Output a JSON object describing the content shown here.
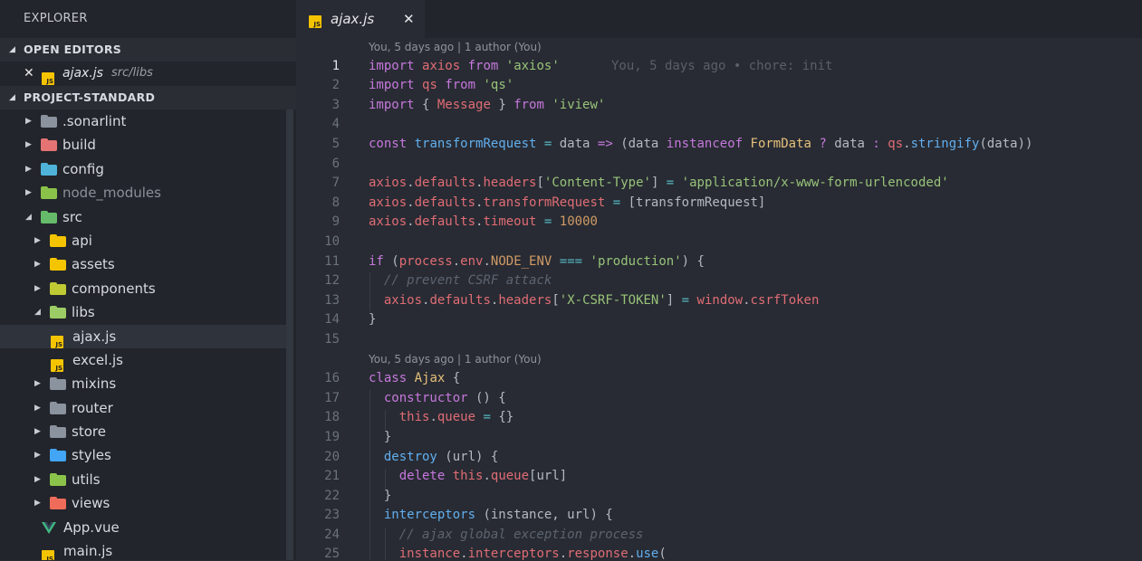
{
  "sidebar": {
    "title": "EXPLORER",
    "open_editors_label": "OPEN EDITORS",
    "open_editor": {
      "close": "✕",
      "name": "ajax.js",
      "path": "src/libs"
    },
    "project_label": "PROJECT-STANDARD",
    "tree": [
      {
        "name": ".sonarlint",
        "kind": "folder",
        "depth": 0,
        "expanded": false,
        "color": "#8a939e"
      },
      {
        "name": "build",
        "kind": "folder",
        "depth": 0,
        "expanded": false,
        "color": "#e57373"
      },
      {
        "name": "config",
        "kind": "folder",
        "depth": 0,
        "expanded": false,
        "color": "#4fb3d9"
      },
      {
        "name": "node_modules",
        "kind": "folder",
        "depth": 0,
        "expanded": false,
        "color": "#8bc34a"
      },
      {
        "name": "src",
        "kind": "folder",
        "depth": 0,
        "expanded": true,
        "color": "#66bb6a"
      },
      {
        "name": "api",
        "kind": "folder",
        "depth": 1,
        "expanded": false,
        "color": "#f5c400"
      },
      {
        "name": "assets",
        "kind": "folder",
        "depth": 1,
        "expanded": false,
        "color": "#f5c400"
      },
      {
        "name": "components",
        "kind": "folder",
        "depth": 1,
        "expanded": false,
        "color": "#c0ca33"
      },
      {
        "name": "libs",
        "kind": "folder",
        "depth": 1,
        "expanded": true,
        "color": "#9ccc65"
      },
      {
        "name": "ajax.js",
        "kind": "js",
        "depth": 2,
        "selected": true
      },
      {
        "name": "excel.js",
        "kind": "js",
        "depth": 2
      },
      {
        "name": "mixins",
        "kind": "folder",
        "depth": 1,
        "expanded": false,
        "color": "#8a939e"
      },
      {
        "name": "router",
        "kind": "folder",
        "depth": 1,
        "expanded": false,
        "color": "#8a939e"
      },
      {
        "name": "store",
        "kind": "folder",
        "depth": 1,
        "expanded": false,
        "color": "#8a939e"
      },
      {
        "name": "styles",
        "kind": "folder",
        "depth": 1,
        "expanded": false,
        "color": "#42a5f5"
      },
      {
        "name": "utils",
        "kind": "folder",
        "depth": 1,
        "expanded": false,
        "color": "#8bc34a"
      },
      {
        "name": "views",
        "kind": "folder",
        "depth": 1,
        "expanded": false,
        "color": "#ef6c5a"
      },
      {
        "name": "App.vue",
        "kind": "vue",
        "depth": 1
      },
      {
        "name": "main.js",
        "kind": "js",
        "depth": 1
      }
    ]
  },
  "tab": {
    "icon": "js-file-icon",
    "label": "ajax.js",
    "close": "✕"
  },
  "editor": {
    "lens_1": "You, 5 days ago | 1 author (You)",
    "lens_2": "You, 5 days ago | 1 author (You)",
    "blame_line1": "You, 5 days ago • chore: init",
    "line_numbers": [
      "1",
      "2",
      "3",
      "4",
      "5",
      "6",
      "7",
      "8",
      "9",
      "10",
      "11",
      "12",
      "13",
      "14",
      "15",
      "16",
      "17",
      "18",
      "19",
      "20",
      "21",
      "22",
      "23",
      "24",
      "25"
    ]
  },
  "colors": {
    "keyword": "#c678dd",
    "string": "#98c379",
    "variable": "#e06c75",
    "function": "#61afef",
    "type": "#e5c07b",
    "number": "#d19a66",
    "comment": "#5c6370"
  }
}
